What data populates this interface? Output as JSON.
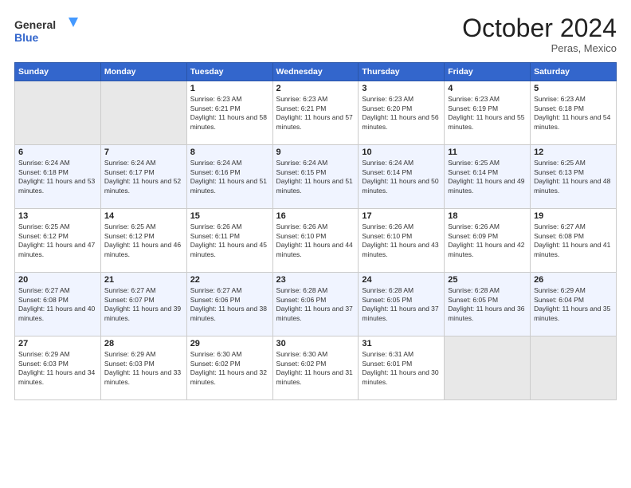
{
  "header": {
    "logo_line1": "General",
    "logo_line2": "Blue",
    "month": "October 2024",
    "location": "Peras, Mexico"
  },
  "weekdays": [
    "Sunday",
    "Monday",
    "Tuesday",
    "Wednesday",
    "Thursday",
    "Friday",
    "Saturday"
  ],
  "weeks": [
    [
      {
        "day": "",
        "empty": true
      },
      {
        "day": "",
        "empty": true
      },
      {
        "day": "1",
        "sunrise": "6:23 AM",
        "sunset": "6:21 PM",
        "daylight": "11 hours and 58 minutes."
      },
      {
        "day": "2",
        "sunrise": "6:23 AM",
        "sunset": "6:21 PM",
        "daylight": "11 hours and 57 minutes."
      },
      {
        "day": "3",
        "sunrise": "6:23 AM",
        "sunset": "6:20 PM",
        "daylight": "11 hours and 56 minutes."
      },
      {
        "day": "4",
        "sunrise": "6:23 AM",
        "sunset": "6:19 PM",
        "daylight": "11 hours and 55 minutes."
      },
      {
        "day": "5",
        "sunrise": "6:23 AM",
        "sunset": "6:18 PM",
        "daylight": "11 hours and 54 minutes."
      }
    ],
    [
      {
        "day": "6",
        "sunrise": "6:24 AM",
        "sunset": "6:18 PM",
        "daylight": "11 hours and 53 minutes."
      },
      {
        "day": "7",
        "sunrise": "6:24 AM",
        "sunset": "6:17 PM",
        "daylight": "11 hours and 52 minutes."
      },
      {
        "day": "8",
        "sunrise": "6:24 AM",
        "sunset": "6:16 PM",
        "daylight": "11 hours and 51 minutes."
      },
      {
        "day": "9",
        "sunrise": "6:24 AM",
        "sunset": "6:15 PM",
        "daylight": "11 hours and 51 minutes."
      },
      {
        "day": "10",
        "sunrise": "6:24 AM",
        "sunset": "6:14 PM",
        "daylight": "11 hours and 50 minutes."
      },
      {
        "day": "11",
        "sunrise": "6:25 AM",
        "sunset": "6:14 PM",
        "daylight": "11 hours and 49 minutes."
      },
      {
        "day": "12",
        "sunrise": "6:25 AM",
        "sunset": "6:13 PM",
        "daylight": "11 hours and 48 minutes."
      }
    ],
    [
      {
        "day": "13",
        "sunrise": "6:25 AM",
        "sunset": "6:12 PM",
        "daylight": "11 hours and 47 minutes."
      },
      {
        "day": "14",
        "sunrise": "6:25 AM",
        "sunset": "6:12 PM",
        "daylight": "11 hours and 46 minutes."
      },
      {
        "day": "15",
        "sunrise": "6:26 AM",
        "sunset": "6:11 PM",
        "daylight": "11 hours and 45 minutes."
      },
      {
        "day": "16",
        "sunrise": "6:26 AM",
        "sunset": "6:10 PM",
        "daylight": "11 hours and 44 minutes."
      },
      {
        "day": "17",
        "sunrise": "6:26 AM",
        "sunset": "6:10 PM",
        "daylight": "11 hours and 43 minutes."
      },
      {
        "day": "18",
        "sunrise": "6:26 AM",
        "sunset": "6:09 PM",
        "daylight": "11 hours and 42 minutes."
      },
      {
        "day": "19",
        "sunrise": "6:27 AM",
        "sunset": "6:08 PM",
        "daylight": "11 hours and 41 minutes."
      }
    ],
    [
      {
        "day": "20",
        "sunrise": "6:27 AM",
        "sunset": "6:08 PM",
        "daylight": "11 hours and 40 minutes."
      },
      {
        "day": "21",
        "sunrise": "6:27 AM",
        "sunset": "6:07 PM",
        "daylight": "11 hours and 39 minutes."
      },
      {
        "day": "22",
        "sunrise": "6:27 AM",
        "sunset": "6:06 PM",
        "daylight": "11 hours and 38 minutes."
      },
      {
        "day": "23",
        "sunrise": "6:28 AM",
        "sunset": "6:06 PM",
        "daylight": "11 hours and 37 minutes."
      },
      {
        "day": "24",
        "sunrise": "6:28 AM",
        "sunset": "6:05 PM",
        "daylight": "11 hours and 37 minutes."
      },
      {
        "day": "25",
        "sunrise": "6:28 AM",
        "sunset": "6:05 PM",
        "daylight": "11 hours and 36 minutes."
      },
      {
        "day": "26",
        "sunrise": "6:29 AM",
        "sunset": "6:04 PM",
        "daylight": "11 hours and 35 minutes."
      }
    ],
    [
      {
        "day": "27",
        "sunrise": "6:29 AM",
        "sunset": "6:03 PM",
        "daylight": "11 hours and 34 minutes."
      },
      {
        "day": "28",
        "sunrise": "6:29 AM",
        "sunset": "6:03 PM",
        "daylight": "11 hours and 33 minutes."
      },
      {
        "day": "29",
        "sunrise": "6:30 AM",
        "sunset": "6:02 PM",
        "daylight": "11 hours and 32 minutes."
      },
      {
        "day": "30",
        "sunrise": "6:30 AM",
        "sunset": "6:02 PM",
        "daylight": "11 hours and 31 minutes."
      },
      {
        "day": "31",
        "sunrise": "6:31 AM",
        "sunset": "6:01 PM",
        "daylight": "11 hours and 30 minutes."
      },
      {
        "day": "",
        "empty": true
      },
      {
        "day": "",
        "empty": true
      }
    ]
  ]
}
